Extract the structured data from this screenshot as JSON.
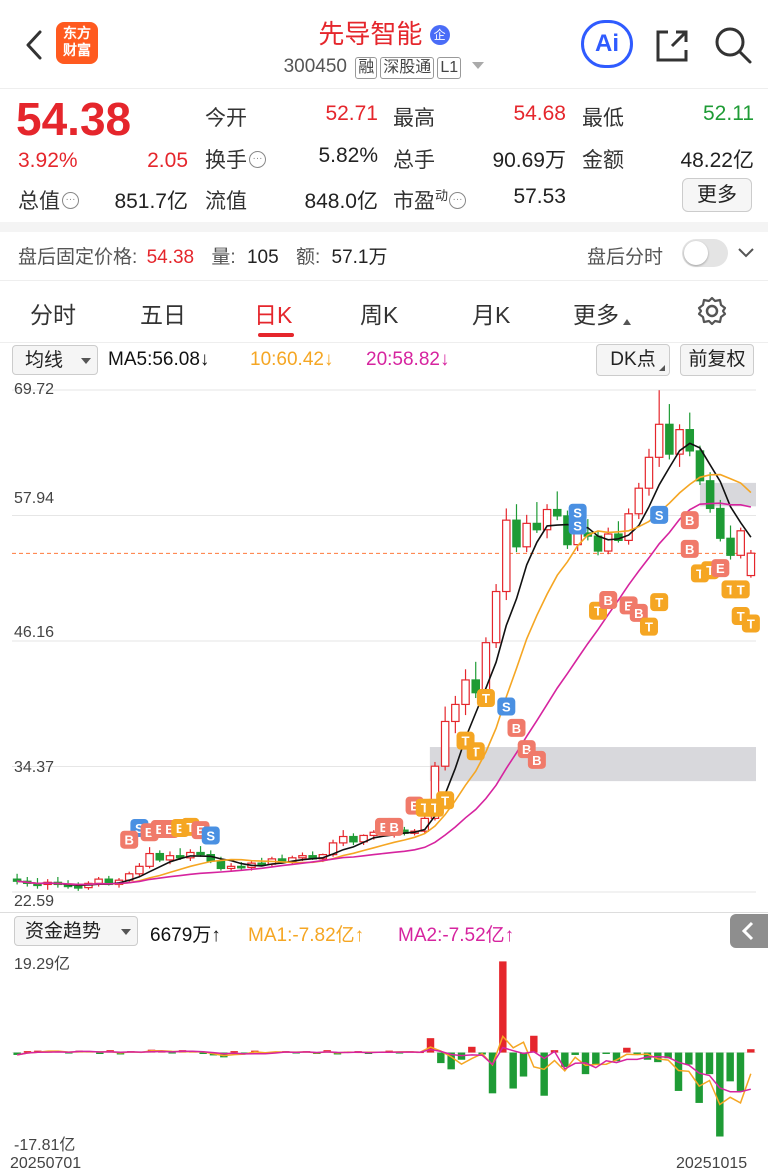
{
  "header": {
    "stock_name": "先导智能",
    "name_badge": "企",
    "code": "300450",
    "tags": [
      "融",
      "深股通",
      "L1"
    ],
    "logo_text": [
      "东方",
      "财富"
    ],
    "ai_label": "Ai"
  },
  "quote": {
    "price": "54.38",
    "change_pct": "3.92%",
    "change_amt": "2.05",
    "rows": [
      [
        {
          "label": "今开",
          "value": "52.71",
          "color": "red"
        },
        {
          "label": "最高",
          "value": "54.68",
          "color": "red"
        },
        {
          "label": "最低",
          "value": "52.11",
          "color": "green"
        }
      ],
      [
        {
          "label": "换手",
          "value": "5.82%",
          "color": "black"
        },
        {
          "label": "总手",
          "value": "90.69万",
          "color": "black"
        },
        {
          "label": "金额",
          "value": "48.22亿",
          "color": "black"
        }
      ],
      [
        {
          "label": "流值",
          "value": "848.0亿",
          "color": "black"
        },
        {
          "label": "市盈",
          "value": "57.53",
          "color": "black"
        }
      ]
    ],
    "total_value_label": "总值",
    "total_value": "851.7亿",
    "pe_sup": "动",
    "more_button": "更多"
  },
  "after_hours": {
    "label": "盘后固定价格:",
    "price": "54.38",
    "vol_label": "量:",
    "vol": "105",
    "amt_label": "额:",
    "amt": "57.1万",
    "toggle_label": "盘后分时"
  },
  "tabs": [
    "分时",
    "五日",
    "日K",
    "周K",
    "月K",
    "更多"
  ],
  "active_tab": "日K",
  "chart_header": {
    "indicator": "均线",
    "ma5": "MA5:56.08↓",
    "ma10": "10:60.42↓",
    "ma20": "20:58.82↓",
    "dk_button": "DK点",
    "adjust_button": "前复权"
  },
  "price_axis": [
    "69.72",
    "57.94",
    "46.16",
    "34.37",
    "22.59"
  ],
  "fund_header": {
    "indicator": "资金趋势",
    "value": "6679万↑",
    "ma1": "MA1:-7.82亿↑",
    "ma2": "MA2:-7.52亿↑"
  },
  "fund_axis": [
    "19.29亿",
    "-17.81亿"
  ],
  "date_start": "20250701",
  "date_end": "20251015",
  "colors": {
    "up": "#e5262c",
    "down": "#1e9b35",
    "ma5": "#111111",
    "ma10": "#f5a623",
    "ma20": "#d6249f",
    "accent": "#ff5a1f"
  },
  "chart_data": {
    "type": "candlestick",
    "ylim": [
      22.59,
      69.72
    ],
    "ohlc": [
      [
        23.8,
        24.3,
        23.3,
        23.6
      ],
      [
        23.6,
        24.0,
        23.1,
        23.4
      ],
      [
        23.4,
        23.9,
        22.9,
        23.2
      ],
      [
        23.3,
        23.8,
        22.8,
        23.5
      ],
      [
        23.5,
        24.0,
        23.0,
        23.3
      ],
      [
        23.3,
        23.7,
        22.9,
        23.1
      ],
      [
        23.1,
        23.5,
        22.7,
        23.0
      ],
      [
        23.0,
        23.6,
        22.8,
        23.4
      ],
      [
        23.4,
        24.0,
        23.1,
        23.8
      ],
      [
        23.8,
        24.1,
        23.2,
        23.3
      ],
      [
        23.3,
        23.9,
        23.0,
        23.7
      ],
      [
        23.7,
        24.5,
        23.5,
        24.3
      ],
      [
        24.3,
        25.3,
        24.1,
        25.0
      ],
      [
        25.0,
        26.8,
        24.8,
        26.2
      ],
      [
        26.2,
        26.5,
        25.4,
        25.6
      ],
      [
        25.6,
        26.4,
        25.2,
        26.0
      ],
      [
        26.0,
        26.7,
        25.6,
        25.8
      ],
      [
        25.8,
        26.6,
        25.5,
        26.3
      ],
      [
        26.3,
        26.9,
        25.9,
        26.1
      ],
      [
        26.1,
        26.5,
        25.3,
        25.5
      ],
      [
        25.5,
        25.9,
        24.6,
        24.8
      ],
      [
        24.8,
        25.3,
        24.5,
        25.0
      ],
      [
        25.0,
        25.4,
        24.7,
        24.9
      ],
      [
        24.9,
        25.5,
        24.6,
        25.3
      ],
      [
        25.3,
        25.8,
        25.0,
        25.2
      ],
      [
        25.2,
        25.9,
        25.0,
        25.7
      ],
      [
        25.7,
        26.1,
        25.3,
        25.4
      ],
      [
        25.4,
        26.0,
        25.2,
        25.8
      ],
      [
        25.8,
        26.3,
        25.5,
        26.0
      ],
      [
        26.0,
        26.4,
        25.6,
        25.7
      ],
      [
        25.7,
        26.2,
        25.4,
        26.1
      ],
      [
        26.1,
        27.5,
        25.9,
        27.2
      ],
      [
        27.2,
        28.4,
        26.9,
        27.8
      ],
      [
        27.8,
        28.1,
        27.0,
        27.3
      ],
      [
        27.3,
        28.0,
        27.0,
        27.9
      ],
      [
        27.9,
        28.4,
        27.5,
        28.2
      ],
      [
        28.2,
        28.5,
        27.8,
        28.0
      ],
      [
        28.0,
        28.6,
        27.7,
        28.4
      ],
      [
        28.4,
        28.7,
        27.9,
        28.1
      ],
      [
        28.1,
        28.5,
        27.9,
        28.3
      ],
      [
        28.3,
        29.8,
        28.1,
        29.5
      ],
      [
        29.5,
        34.8,
        29.3,
        34.4
      ],
      [
        34.4,
        40.0,
        34.0,
        38.6
      ],
      [
        38.6,
        41.0,
        37.5,
        40.2
      ],
      [
        40.2,
        43.5,
        39.2,
        42.5
      ],
      [
        42.5,
        44.2,
        40.8,
        41.3
      ],
      [
        41.3,
        46.5,
        41.0,
        46.0
      ],
      [
        46.0,
        51.5,
        45.5,
        50.8
      ],
      [
        50.8,
        58.6,
        50.0,
        57.5
      ],
      [
        57.5,
        59.0,
        54.5,
        55.0
      ],
      [
        55.0,
        58.0,
        54.5,
        57.2
      ],
      [
        57.2,
        59.2,
        56.3,
        56.6
      ],
      [
        56.6,
        59.0,
        55.8,
        58.5
      ],
      [
        58.5,
        60.2,
        57.5,
        57.9
      ],
      [
        57.9,
        58.4,
        54.8,
        55.2
      ],
      [
        55.2,
        56.8,
        54.6,
        56.3
      ],
      [
        56.3,
        57.6,
        55.6,
        56.0
      ],
      [
        56.0,
        56.5,
        54.2,
        54.6
      ],
      [
        54.6,
        56.8,
        54.3,
        56.2
      ],
      [
        56.2,
        57.4,
        55.4,
        55.6
      ],
      [
        55.6,
        58.6,
        55.2,
        58.1
      ],
      [
        58.1,
        61.0,
        57.6,
        60.5
      ],
      [
        60.5,
        64.2,
        59.8,
        63.4
      ],
      [
        63.4,
        69.7,
        62.5,
        66.5
      ],
      [
        66.5,
        68.4,
        63.2,
        63.7
      ],
      [
        63.7,
        66.5,
        62.5,
        66.0
      ],
      [
        66.0,
        67.6,
        63.5,
        64.0
      ],
      [
        64.0,
        64.5,
        60.8,
        61.2
      ],
      [
        61.2,
        62.0,
        58.2,
        58.6
      ],
      [
        58.6,
        59.4,
        55.5,
        55.8
      ],
      [
        55.8,
        57.0,
        53.8,
        54.2
      ],
      [
        54.2,
        56.8,
        53.9,
        56.5
      ],
      [
        52.3,
        54.7,
        52.1,
        54.4
      ]
    ],
    "fund_flow_yi": [
      -0.5,
      0.3,
      0.4,
      0.2,
      0.3,
      -0.2,
      0.4,
      0.3,
      -0.3,
      0.5,
      -0.4,
      0.3,
      0.2,
      0.6,
      0.3,
      -0.2,
      0.5,
      0.2,
      -0.3,
      -0.6,
      -1.0,
      0.3,
      -0.3,
      0.4,
      -0.2,
      0.2,
      0.3,
      -0.2,
      0.3,
      -0.3,
      0.5,
      -0.4,
      0.2,
      0.3,
      -0.3,
      0.2,
      0.4,
      -0.2,
      0.3,
      0.1,
      3.0,
      -2.2,
      -3.5,
      -1.5,
      1.2,
      -0.4,
      -8.5,
      19.0,
      -7.5,
      -5.0,
      3.5,
      -9.0,
      0.5,
      -3.0,
      -0.5,
      -4.5,
      -2.5,
      -0.3,
      -1.8,
      1.0,
      -0.5,
      -1.5,
      -2.0,
      -1.2,
      -8.0,
      -2.5,
      -10.5,
      -4.5,
      -17.5,
      -6.0,
      -8.0,
      0.7
    ]
  }
}
